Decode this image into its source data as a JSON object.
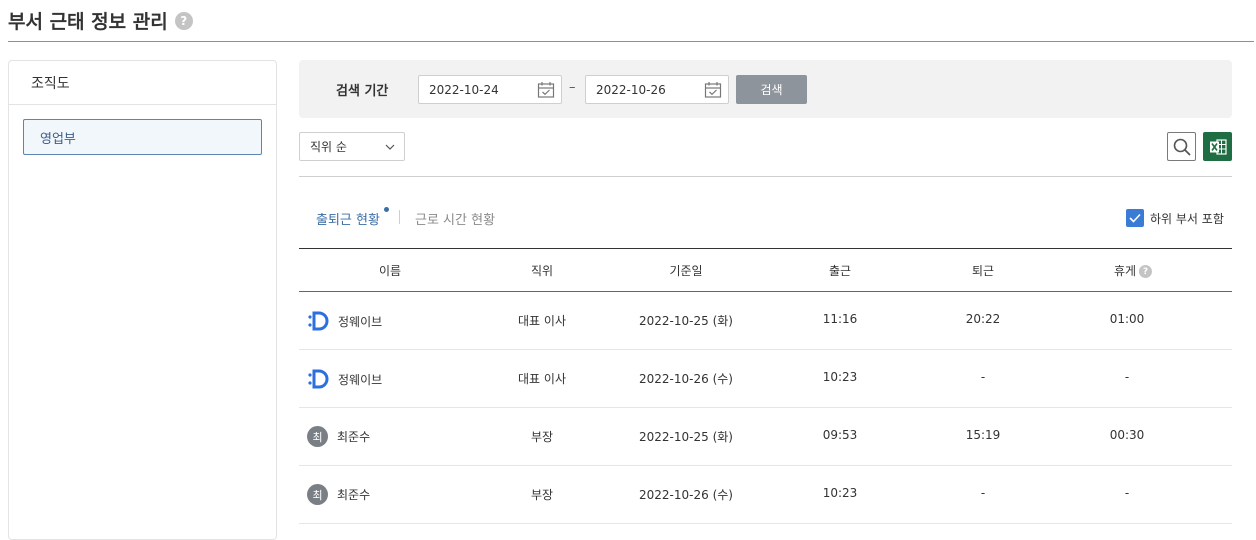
{
  "page": {
    "title": "부서 근태 정보 관리",
    "help": "?"
  },
  "org": {
    "header": "조직도",
    "items": [
      {
        "label": "영업부"
      }
    ]
  },
  "search": {
    "label": "검색 기간",
    "start_date": "2022-10-24",
    "separator": "–",
    "end_date": "2022-10-26",
    "button": "검색"
  },
  "toolbar": {
    "sort": "직위 순",
    "search_icon": "magnifier-icon",
    "excel_icon": "excel-icon"
  },
  "tabs": [
    {
      "label": "출퇴근 현황",
      "active": true
    },
    {
      "label": "근로 시간 현황",
      "active": false
    }
  ],
  "include_sub": {
    "label": "하위 부서 포함",
    "checked": true
  },
  "table": {
    "headers": {
      "name": "이름",
      "position": "직위",
      "date": "기준일",
      "checkin": "출근",
      "checkout": "퇴근",
      "break": "휴게",
      "break_help": "?"
    },
    "rows": [
      {
        "avatar": "D",
        "name": "정웨이브",
        "position": "대표 이사",
        "date": "2022-10-25 (화)",
        "checkin": "11:16",
        "checkout": "20:22",
        "break": "01:00"
      },
      {
        "avatar": "D",
        "name": "정웨이브",
        "position": "대표 이사",
        "date": "2022-10-26 (수)",
        "checkin": "10:23",
        "checkout": "-",
        "break": "-"
      },
      {
        "avatar": "최",
        "name": "최준수",
        "position": "부장",
        "date": "2022-10-25 (화)",
        "checkin": "09:53",
        "checkout": "15:19",
        "break": "00:30"
      },
      {
        "avatar": "최",
        "name": "최준수",
        "position": "부장",
        "date": "2022-10-26 (수)",
        "checkin": "10:23",
        "checkout": "-",
        "break": "-"
      }
    ]
  },
  "colors": {
    "accent": "#3a6ea5",
    "excel": "#1f6e43",
    "checkbox": "#3a7bd5",
    "button": "#8e949c"
  }
}
